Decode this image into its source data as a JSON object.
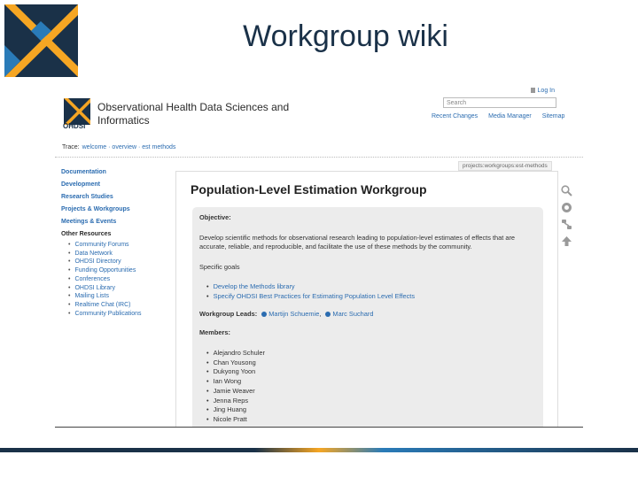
{
  "slide": {
    "title": "Workgroup wiki"
  },
  "site": {
    "title_line1": "Observational Health Data Sciences and",
    "title_line2": "Informatics",
    "logo_text": "OHDSI",
    "login": "Log In",
    "search_placeholder": "Search",
    "tool_links": [
      "Recent Changes",
      "Media Manager",
      "Sitemap"
    ],
    "breadcrumb_label": "Trace:",
    "breadcrumb": "welcome · overview · est methods",
    "page_path": "projects:workgroups:est-methods"
  },
  "sidebar": {
    "items": [
      "Documentation",
      "Development",
      "Research Studies",
      "Projects & Workgroups",
      "Meetings & Events"
    ],
    "other_heading": "Other Resources",
    "other_links": [
      "Community Forums",
      "Data Network",
      "OHDSI Directory",
      "Funding Opportunities",
      "Conferences",
      "OHDSI Library",
      "Mailing Lists",
      "Realtime Chat (IRC)",
      "Community Publications"
    ]
  },
  "page": {
    "heading": "Population-Level Estimation Workgroup",
    "objective_label": "Objective:",
    "objective_text": "Develop scientific methods for observational research leading to population-level estimates of effects that are accurate, reliable, and reproducible, and facilitate the use of these methods by the community.",
    "goals_label": "Specific goals",
    "goals": [
      "Develop the Methods library",
      "Specify OHDSI Best Practices for Estimating Population Level Effects"
    ],
    "leads_label": "Workgroup Leads:",
    "leads": [
      "Martijn Schuemie",
      "Marc Suchard"
    ],
    "members_label": "Members:",
    "members": [
      "Alejandro Schuler",
      "Chan Yousong",
      "Dukyong Yoon",
      "Ian Wong",
      "Jamie Weaver",
      "Jenna Reps",
      "Jing Huang",
      "Nicole Pratt"
    ]
  },
  "page_tools": [
    "search-icon",
    "circle-icon",
    "backlinks-icon",
    "up-arrow-icon"
  ],
  "colors": {
    "link": "#2b6cb0",
    "title": "#1a3148",
    "logo_navy": "#1a3148",
    "logo_orange": "#f6a623",
    "logo_blue": "#2a7bb8"
  }
}
